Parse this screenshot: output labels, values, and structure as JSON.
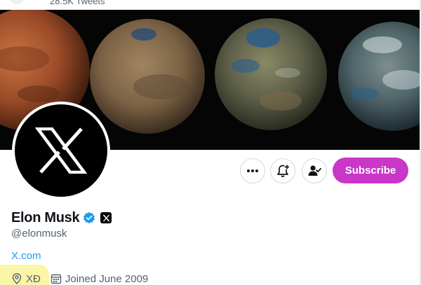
{
  "header": {
    "tweet_count": "28.5K Tweets"
  },
  "banner": {
    "description_icon": "planet-terraforming-banner"
  },
  "profile": {
    "display_name": "Elon Musk",
    "handle": "@elonmusk",
    "website": "X.com",
    "location": "XĐ",
    "joined": "Joined June 2009"
  },
  "actions": {
    "more_icon": "more-icon",
    "notify_icon": "bell-plus-icon",
    "following_icon": "person-check-icon",
    "subscribe_label": "Subscribe"
  },
  "colors": {
    "subscribe": "#c936c8",
    "link": "#1d9bf0",
    "verified": "#1d9bf0",
    "muted": "#536471",
    "highlight": "#fbf5a6"
  }
}
